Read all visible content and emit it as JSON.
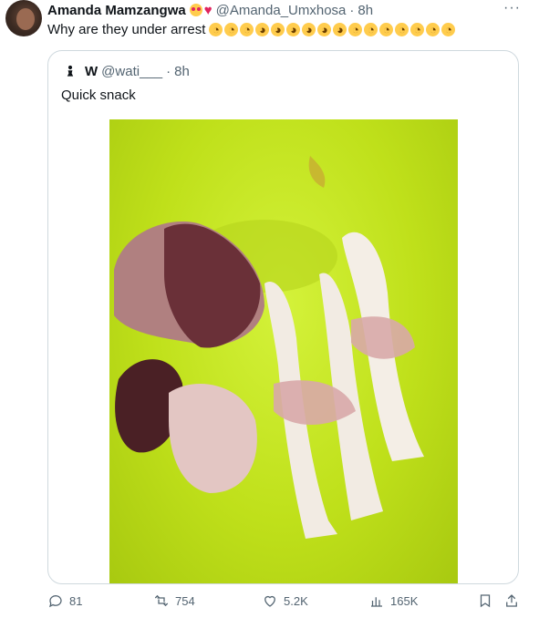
{
  "tweet": {
    "author": {
      "display_name": "Amanda Mamzangwa",
      "name_emojis": [
        "smiling-face-with-heart-eyes",
        "red-heart"
      ],
      "handle": "@Amanda_Umxhosa",
      "separator": "·",
      "time": "8h"
    },
    "more_label": "···",
    "text": "Why are they under arrest",
    "text_emojis": [
      "crying",
      "crying",
      "crying",
      "laughing",
      "laughing",
      "laughing",
      "laughing",
      "laughing",
      "laughing",
      "crying",
      "crying",
      "crying",
      "crying",
      "crying",
      "crying",
      "crying"
    ]
  },
  "quote": {
    "author": {
      "display_name": "W",
      "handle": "@wati___",
      "separator": "·",
      "time": "8h"
    },
    "text": "Quick snack"
  },
  "actions": {
    "replies": "81",
    "retweets": "754",
    "likes": "5.2K",
    "views": "165K"
  },
  "colors": {
    "secondary_text": "#536471",
    "border": "#cfd9de",
    "bucket_green": "#c4e41f"
  }
}
